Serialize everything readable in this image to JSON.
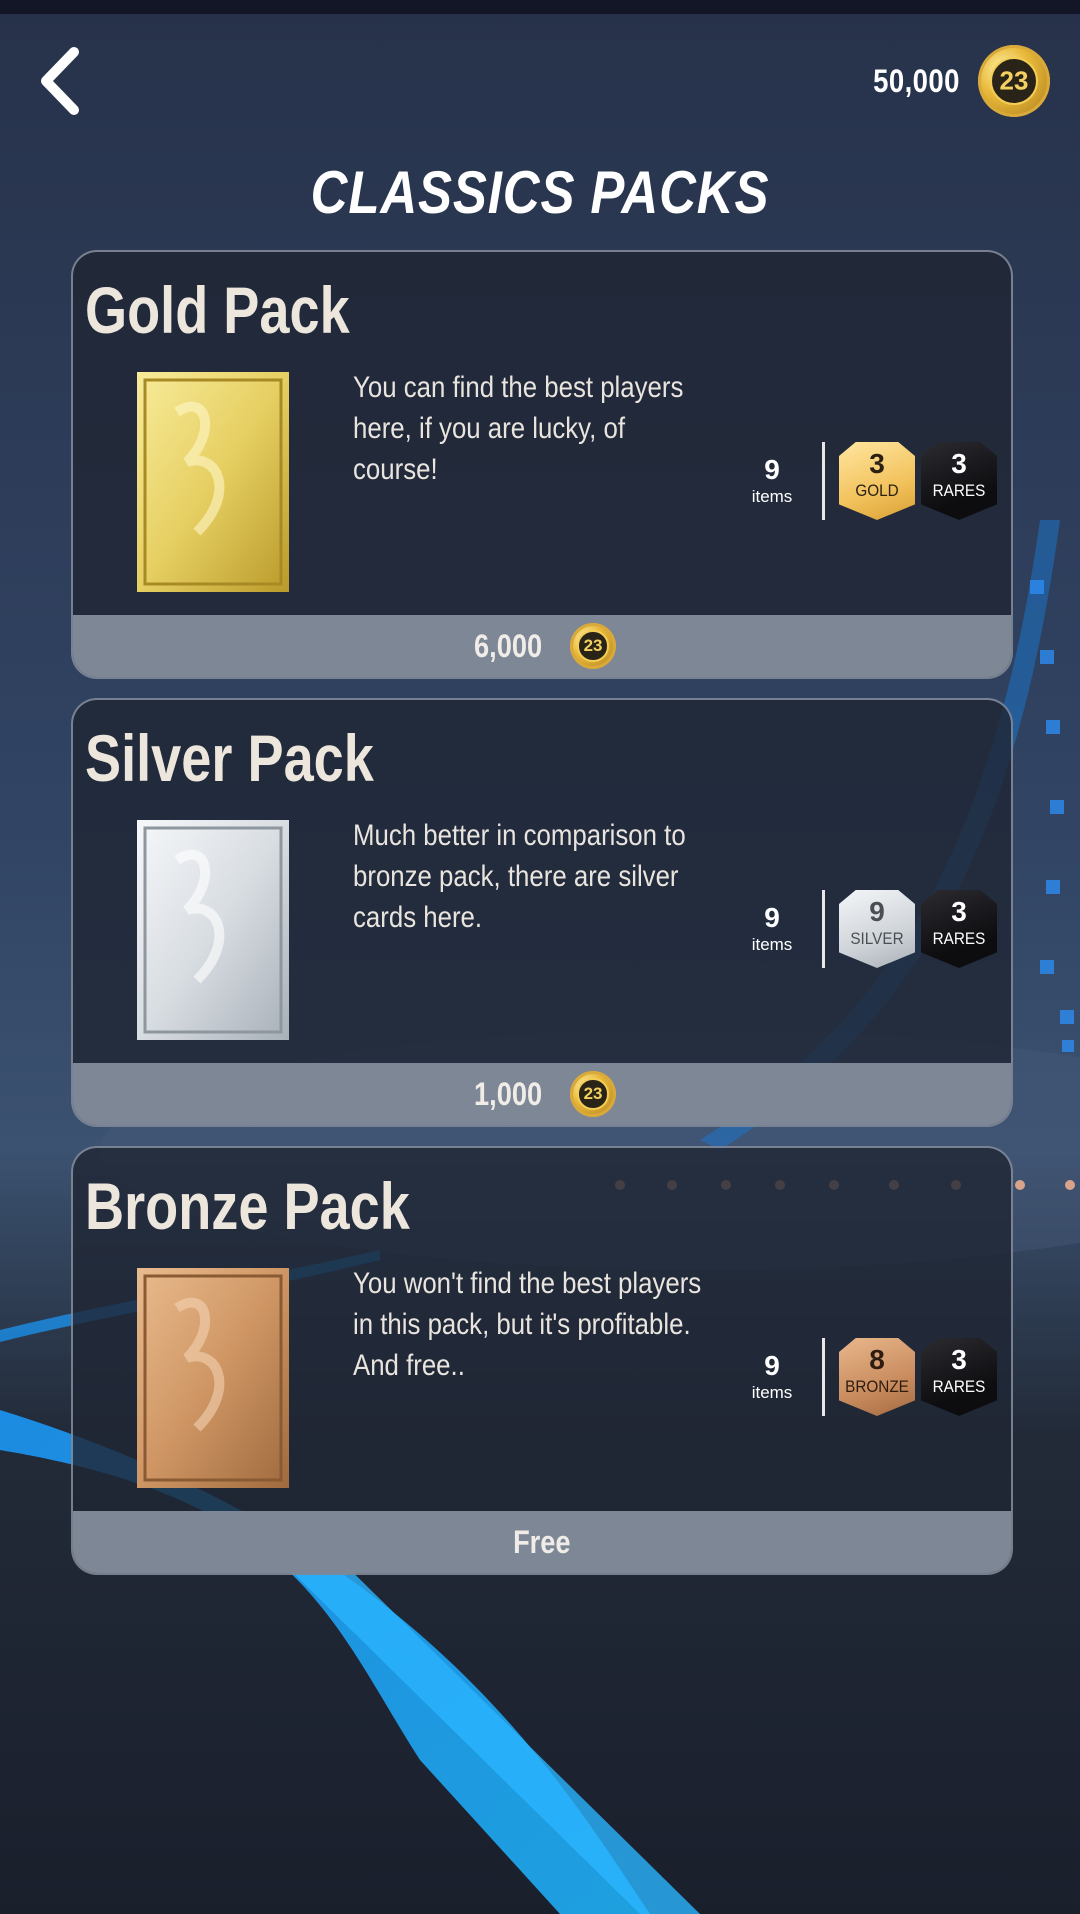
{
  "header": {
    "coin_balance": "50,000",
    "coin_icon_text": "23",
    "title": "CLASSICS PACKS"
  },
  "packs": [
    {
      "name": "Gold Pack",
      "description": "You can find the best players here, if you are lucky, of course!",
      "items_count": "9",
      "items_label": "items",
      "tier_count": "3",
      "tier_label": "GOLD",
      "rares_count": "3",
      "rares_label": "RARES",
      "price": "6,000",
      "coin_icon_text": "23"
    },
    {
      "name": "Silver Pack",
      "description": "Much better in comparison to bronze pack, there are silver cards here.",
      "items_count": "9",
      "items_label": "items",
      "tier_count": "9",
      "tier_label": "SILVER",
      "rares_count": "3",
      "rares_label": "RARES",
      "price": "1,000",
      "coin_icon_text": "23"
    },
    {
      "name": "Bronze Pack",
      "description": "You won't find the best players in this pack, but it's profitable. And free..",
      "items_count": "9",
      "items_label": "items",
      "tier_count": "8",
      "tier_label": "BRONZE",
      "rares_count": "3",
      "rares_label": "RARES",
      "price": "Free"
    }
  ],
  "colors": {
    "background": "#1c2434",
    "card_background": "#1f2533",
    "price_bar": "#7e8796",
    "gold": "#f2c25c",
    "silver": "#cfd4d9",
    "bronze": "#c98c5e",
    "rares": "#0d0d10",
    "accent_blue": "#1fa8ff"
  },
  "icons": {
    "back": "chevron-left-icon",
    "coin": "coin-icon"
  }
}
